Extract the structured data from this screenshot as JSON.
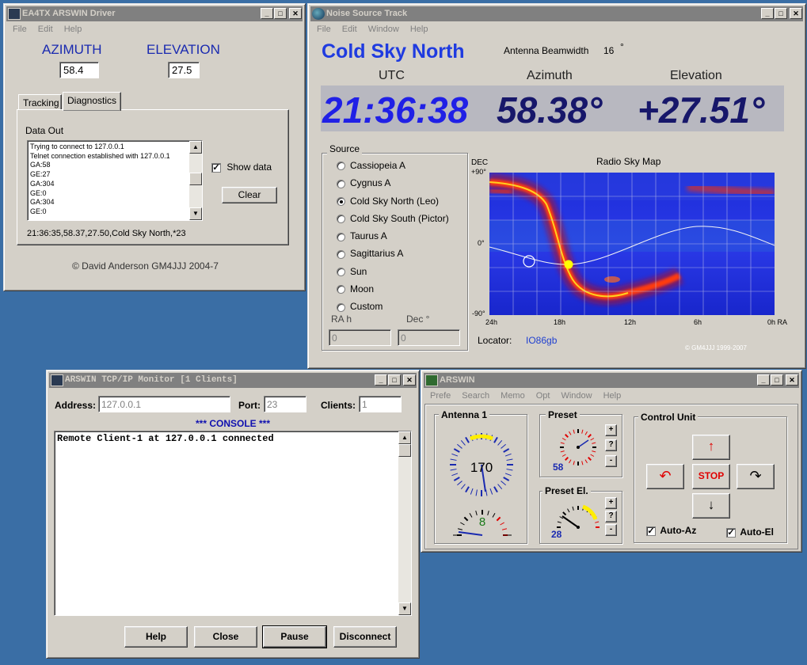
{
  "driver": {
    "title": "EA4TX ARSWIN Driver",
    "menu": [
      "File",
      "Edit",
      "Help"
    ],
    "azimuth_label": "AZIMUTH",
    "elevation_label": "ELEVATION",
    "azimuth_value": "58.4",
    "elevation_value": "27.5",
    "tabs": [
      "Tracking",
      "Diagnostics"
    ],
    "data_out_label": "Data Out",
    "log": [
      "Trying to connect to 127.0.0.1",
      "Telnet connection established with 127.0.0.1",
      "GA:58",
      "GE:27",
      "GA:304",
      "GE:0",
      "GA:304",
      "GE:0"
    ],
    "show_data_label": "Show data",
    "clear_label": "Clear",
    "status_line": "21:36:35,58.37,27.50,Cold Sky North,*23",
    "copyright": "© David Anderson GM4JJJ 2004-7"
  },
  "noise": {
    "title": "Noise Source Track",
    "menu": [
      "File",
      "Edit",
      "Window",
      "Help"
    ],
    "source_name": "Cold Sky North",
    "beamwidth_label": "Antenna Beamwidth",
    "beamwidth_value": "16",
    "beamwidth_unit": "°",
    "utc_label": "UTC",
    "az_label": "Azimuth",
    "el_label": "Elevation",
    "utc_value": "21:36:38",
    "az_value": "58.38°",
    "el_value": "+27.51°",
    "source_group": "Source",
    "sources": [
      "Cassiopeia A",
      "Cygnus A",
      "Cold Sky North (Leo)",
      "Cold Sky South (Pictor)",
      "Taurus A",
      "Sagittarius A",
      "Sun",
      "Moon",
      "Custom"
    ],
    "selected_index": 2,
    "ra_label": "RA h",
    "dec_label": "Dec °",
    "ra_value": "0",
    "dec_value": "0",
    "map_title": "Radio Sky Map",
    "dec_axis": "DEC",
    "dec_ticks": [
      "+90°",
      "0°",
      "-90°"
    ],
    "ra_ticks": [
      "24h",
      "18h",
      "12h",
      "6h",
      "0h RA"
    ],
    "locator_label": "Locator:",
    "locator_value": "IO86gb",
    "copyright": "© GM4JJJ 1999-2007"
  },
  "monitor": {
    "title": "ARSWIN TCP/IP Monitor [1 Clients]",
    "address_label": "Address:",
    "address_value": "127.0.0.1",
    "port_label": "Port:",
    "port_value": "23",
    "clients_label": "Clients:",
    "clients_value": "1",
    "console_label": "*** CONSOLE ***",
    "console_lines": [
      "Remote Client-1 at 127.0.0.1 connected"
    ],
    "buttons": [
      "Help",
      "Close",
      "Pause",
      "Disconnect"
    ]
  },
  "arswin": {
    "title": "ARSWIN",
    "menu": [
      "Prefe",
      "Search",
      "Memo",
      "Opt",
      "Window",
      "Help"
    ],
    "antenna_label": "Antenna 1",
    "az_dial_value": "170",
    "el_dial_value": "8",
    "preset_label": "Preset",
    "preset_value": "58",
    "preset_el_label": "Preset El.",
    "preset_el_value": "28",
    "step_plus": "+",
    "step_help": "?",
    "step_minus": "-",
    "control_label": "Control Unit",
    "stop_label": "STOP",
    "auto_az_label": "Auto-Az",
    "auto_el_label": "Auto-El"
  }
}
